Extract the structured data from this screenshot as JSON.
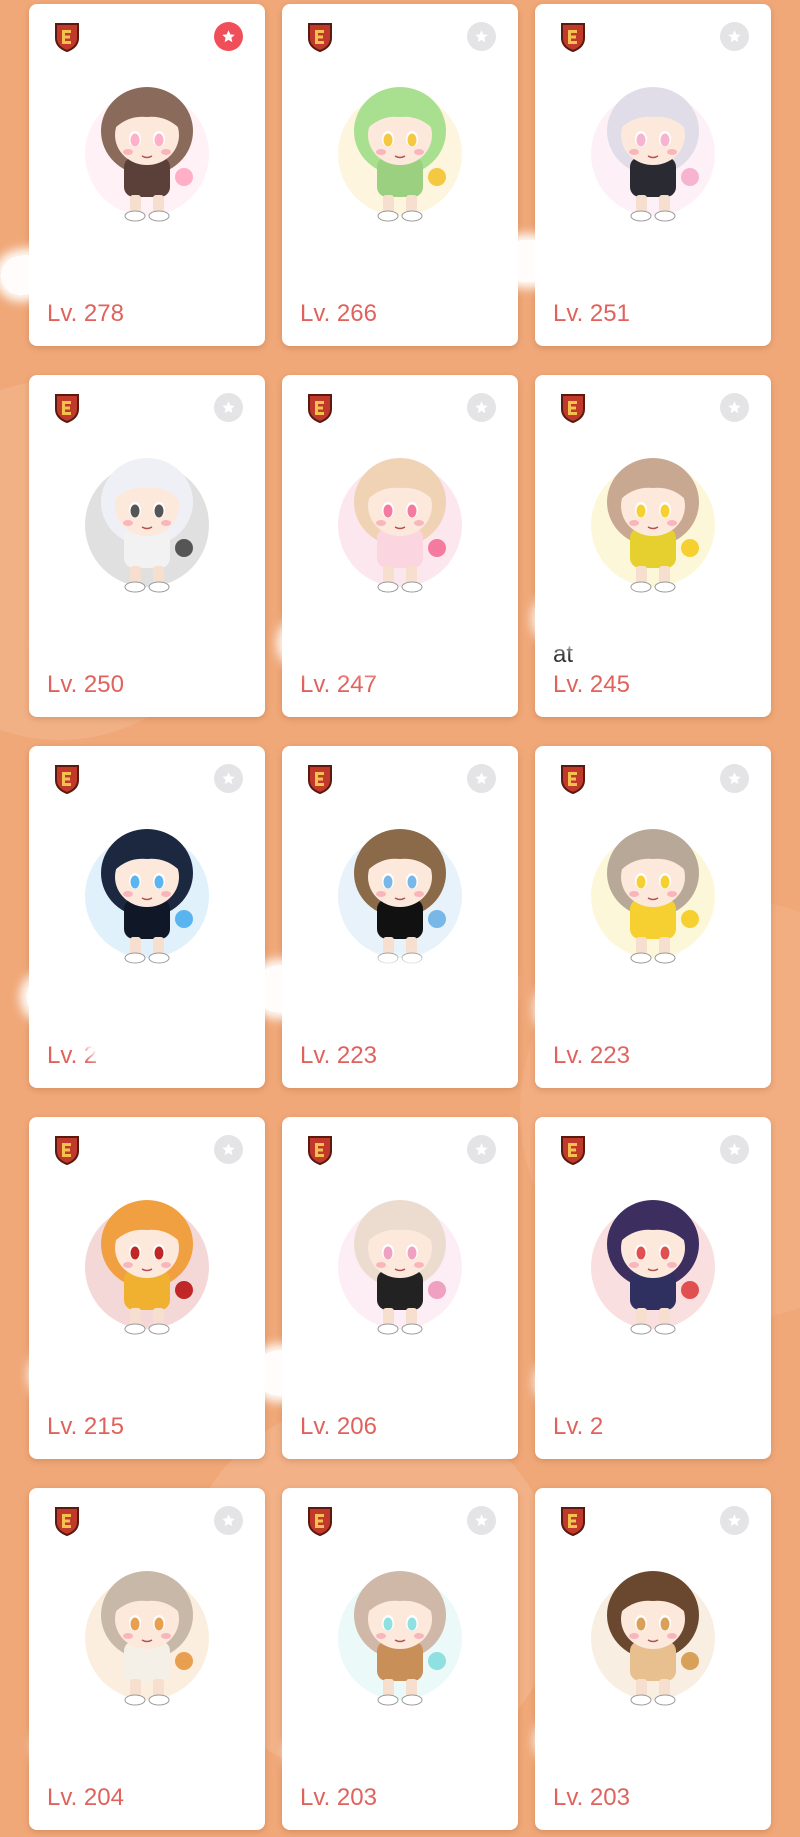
{
  "colors": {
    "background": "#f0a878",
    "card": "#ffffff",
    "level_text": "#e0625c",
    "favorite_active": "#f04f5a",
    "favorite_inactive": "#e4e4e6",
    "job_badge": "#c0392b"
  },
  "characters": [
    {
      "name": "",
      "level": "Lv. 278",
      "favorite": true,
      "hair": "#8a6a5a",
      "outfit": "#5a4038",
      "accent": "#ffb0c8"
    },
    {
      "name": "",
      "level": "Lv. 266",
      "favorite": false,
      "hair": "#a8e090",
      "outfit": "#9ad080",
      "accent": "#f5c842"
    },
    {
      "name": "",
      "level": "Lv. 251",
      "favorite": false,
      "hair": "#e0dde8",
      "outfit": "#2a2a32",
      "accent": "#f6b4d0"
    },
    {
      "name": "",
      "level": "Lv. 250",
      "favorite": false,
      "hair": "#eef0f6",
      "outfit": "#f2f2f2",
      "accent": "#555555"
    },
    {
      "name": "",
      "level": "Lv. 247",
      "favorite": false,
      "hair": "#f0d2b4",
      "outfit": "#fbd6e0",
      "accent": "#f47aa0"
    },
    {
      "name": "at",
      "level": "Lv. 245",
      "favorite": false,
      "hair": "#c8a890",
      "outfit": "#e6d030",
      "accent": "#f5d030"
    },
    {
      "name": "",
      "level": "Lv. 2",
      "favorite": false,
      "hair": "#1c2840",
      "outfit": "#101828",
      "accent": "#5ab4f0"
    },
    {
      "name": "",
      "level": "Lv. 223",
      "favorite": false,
      "hair": "#8a6a48",
      "outfit": "#111111",
      "accent": "#78b8e8"
    },
    {
      "name": "",
      "level": "Lv. 223",
      "favorite": false,
      "hair": "#b8a898",
      "outfit": "#f5d030",
      "accent": "#f5d030"
    },
    {
      "name": "",
      "level": "Lv. 215",
      "favorite": false,
      "hair": "#f0a040",
      "outfit": "#f0b030",
      "accent": "#c02828"
    },
    {
      "name": "",
      "level": "Lv. 206",
      "favorite": false,
      "hair": "#ecdcd0",
      "outfit": "#222222",
      "accent": "#f0a0c0"
    },
    {
      "name": "",
      "level": "Lv. 2",
      "favorite": false,
      "hair": "#3c2e5e",
      "outfit": "#303060",
      "accent": "#e05050"
    },
    {
      "name": "",
      "level": "Lv. 204",
      "favorite": false,
      "hair": "#c8b8a8",
      "outfit": "#f4f0e8",
      "accent": "#e8a050"
    },
    {
      "name": "",
      "level": "Lv. 203",
      "favorite": false,
      "hair": "#d0b8a8",
      "outfit": "#c89058",
      "accent": "#8fe0e0"
    },
    {
      "name": "",
      "level": "Lv. 203",
      "favorite": false,
      "hair": "#6a4830",
      "outfit": "#e8c090",
      "accent": "#d8a058"
    }
  ]
}
